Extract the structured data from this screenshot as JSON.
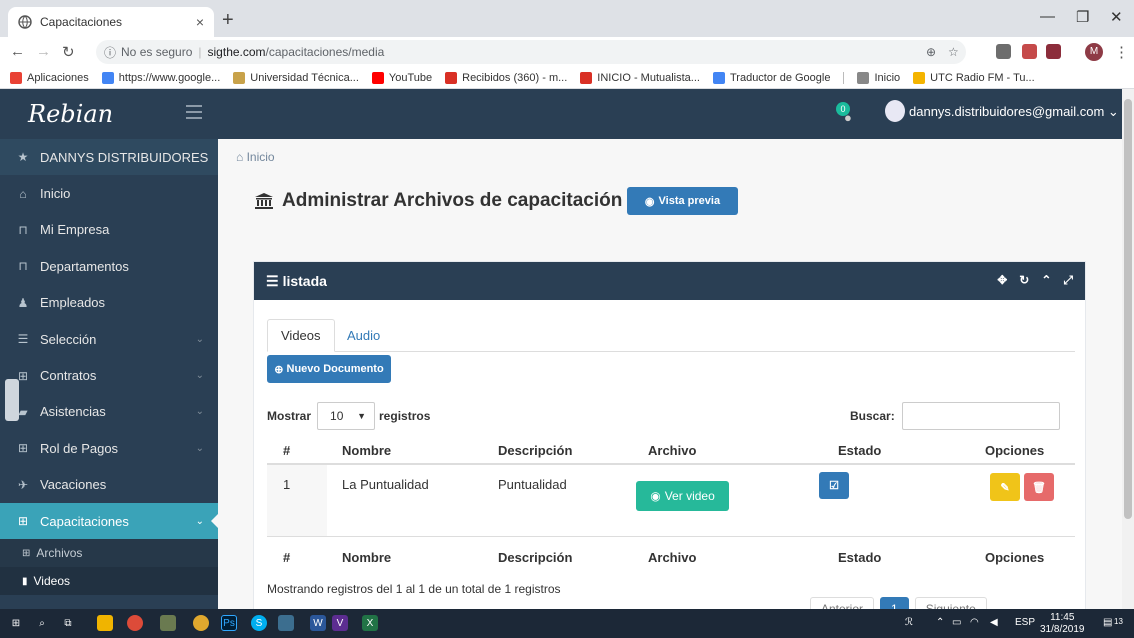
{
  "browser": {
    "tab_title": "Capacitaciones",
    "tab_close": "×",
    "new_tab": "+",
    "url_security": "No es seguro",
    "url_host": "sigthe.com",
    "url_path": "/capacitaciones/media",
    "profile_initial": "M",
    "bookmarks": [
      {
        "label": "Aplicaciones",
        "color": "#e94235"
      },
      {
        "label": "https://www.google...",
        "color": "#4285f4"
      },
      {
        "label": "Universidad Técnica...",
        "color": "#c8a24a"
      },
      {
        "label": "YouTube",
        "color": "#ff0000"
      },
      {
        "label": "Recibidos (360) - m...",
        "color": "#d93025"
      },
      {
        "label": "INICIO - Mutualista...",
        "color": "#d93025"
      },
      {
        "label": "Traductor de Google",
        "color": "#4285f4"
      },
      {
        "label": "Inicio",
        "color": "#888888"
      },
      {
        "label": "UTC Radio FM - Tu...",
        "color": "#f4b400"
      }
    ]
  },
  "sidebar": {
    "brand": "Rebian",
    "items": [
      {
        "label": "DANNYS DISTRIBUIDORES",
        "icon": "★",
        "type": "header"
      },
      {
        "label": "Inicio",
        "icon": "⌂"
      },
      {
        "label": "Mi Empresa",
        "icon": "⊓"
      },
      {
        "label": "Departamentos",
        "icon": "⊓"
      },
      {
        "label": "Empleados",
        "icon": "♟"
      },
      {
        "label": "Selección",
        "icon": "☰",
        "chev": "⌄"
      },
      {
        "label": "Contratos",
        "icon": "⊞",
        "chev": "⌄"
      },
      {
        "label": "Asistencias",
        "icon": "▰",
        "chev": "⌄"
      },
      {
        "label": "Rol de Pagos",
        "icon": "⊞",
        "chev": "⌄"
      },
      {
        "label": "Vacaciones",
        "icon": "✈"
      },
      {
        "label": "Capacitaciones",
        "icon": "⊞",
        "chev": "⌄",
        "type": "active"
      }
    ],
    "subitems": [
      {
        "label": "Archivos",
        "icon": "⊞"
      },
      {
        "label": "Videos",
        "icon": "▮"
      }
    ]
  },
  "topnav": {
    "notif_count": "0",
    "user_email": "dannys.distribuidores@gmail.com ⌄"
  },
  "main": {
    "breadcrumb": "Inicio",
    "page_title": "Administrar Archivos de capacitación",
    "preview_button": "Vista previa",
    "panel_title": "listada",
    "tabs": [
      "Videos",
      "Audio"
    ],
    "new_button": "Nuevo Documento",
    "length_label_before": "Mostrar",
    "length_value": "10",
    "length_label_after": "registros",
    "search_label": "Buscar:",
    "columns": [
      "#",
      "Nombre",
      "Descripción",
      "Archivo",
      "Estado",
      "Opciones"
    ],
    "rows": [
      {
        "num": "1",
        "nombre": "La Puntualidad",
        "descripcion": "Puntualidad",
        "archivo_btn": "Ver video"
      }
    ],
    "info": "Mostrando registros del 1 al 1 de un total de 1 registros",
    "pager": [
      "Anterior",
      "1",
      "Siguiente"
    ]
  },
  "taskbar": {
    "lang": "ESP",
    "time": "11:45",
    "date": "31/8/2019",
    "notif_count": "13"
  },
  "colors": {
    "sidebar_bg": "#2a3f54",
    "active_item": "#3aa3b8",
    "primary": "#337ab7",
    "success": "#26b99a",
    "warning": "#f0c419",
    "danger": "#e66a6a"
  }
}
